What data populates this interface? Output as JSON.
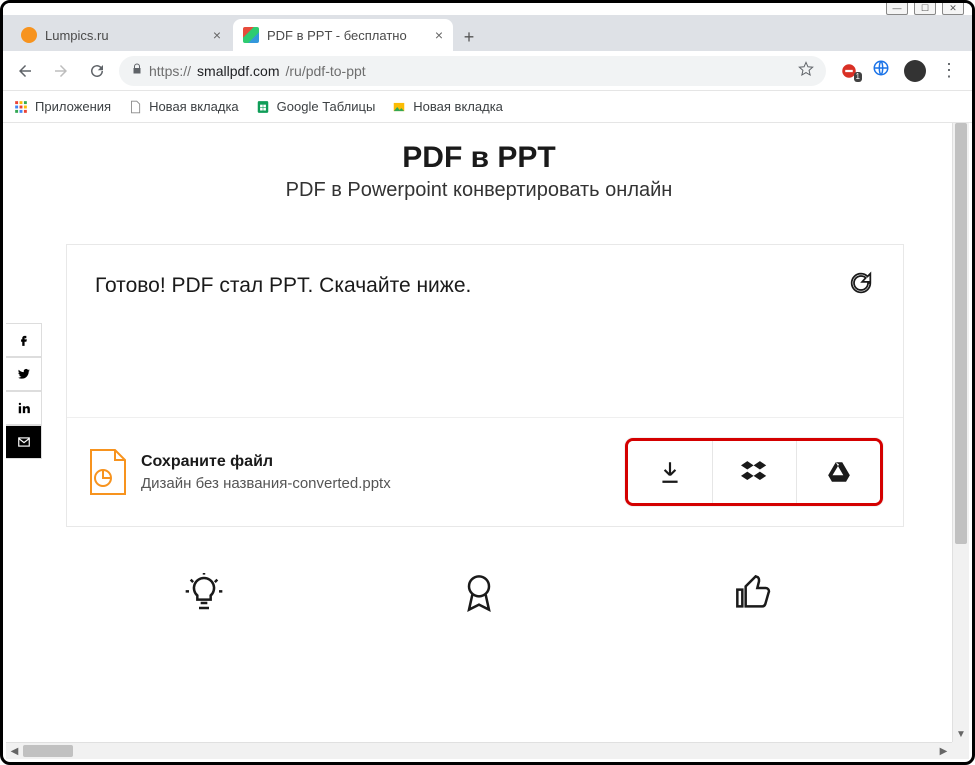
{
  "window": {
    "minimize": "—",
    "maximize": "☐",
    "close": "✕"
  },
  "tabs": {
    "t1": {
      "title": "Lumpics.ru"
    },
    "t2": {
      "title": "PDF в PPT - бесплатно"
    }
  },
  "address": {
    "scheme": "https://",
    "host": "smallpdf.com",
    "path": "/ru/pdf-to-ppt"
  },
  "ext_badge": "1",
  "bookmarks": {
    "apps": "Приложения",
    "b1": "Новая вкладка",
    "b2": "Google Таблицы",
    "b3": "Новая вкладка"
  },
  "page": {
    "title": "PDF в PPT",
    "subtitle": "PDF в Powerpoint конвертировать онлайн",
    "status": "Готово! PDF стал PPT. Скачайте ниже.",
    "save_heading": "Сохраните файл",
    "filename": "Дизайн без названия-converted.pptx"
  }
}
